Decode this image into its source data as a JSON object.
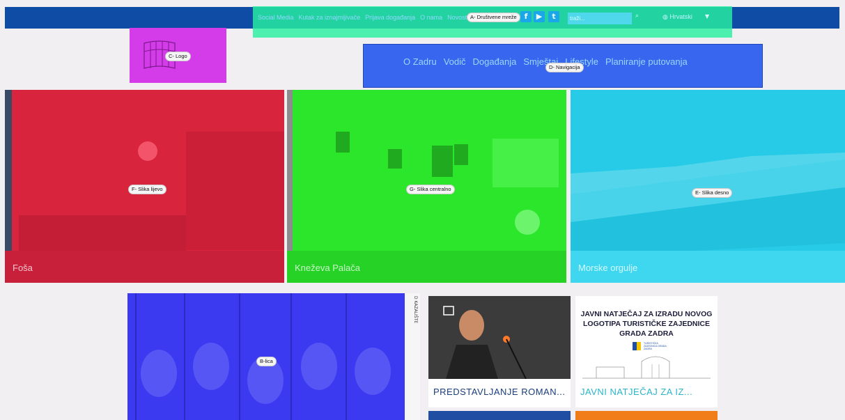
{
  "topbar": {
    "links": [
      "Social Media",
      "Kutak za iznajmljivače",
      "Prijava događanja",
      "O nama",
      "Novosti"
    ],
    "social_icons": [
      "facebook-icon",
      "youtube-icon",
      "twitter-icon"
    ],
    "search_placeholder": "traži...",
    "language": "Hrvatski"
  },
  "zones": {
    "a": "A- Društvene mreže",
    "b": "B-lica",
    "c": "C- Logo",
    "d": "D- Navigacija",
    "e": "E- Slika desno",
    "f": "F- Slika lijevo",
    "g": "G- Slika centralno"
  },
  "nav": {
    "items": [
      "O Zadru",
      "Vodič",
      "Događanja",
      "Smještaj",
      "Lifestyle",
      "Planiranje putovanja"
    ]
  },
  "hero": {
    "left": {
      "caption": "Foša"
    },
    "center": {
      "caption": "Kneževa Palača"
    },
    "right": {
      "caption": "Morske orgulje"
    }
  },
  "cards": [
    {
      "title": "PREDSTAVLJANJE ROMAN...",
      "title_color": "#1a3d7c"
    },
    {
      "title": "JAVNI NATJEČAJ ZA IZ...",
      "title_color": "#2ab4c8"
    }
  ],
  "card2_image_text": {
    "headline": "JAVNI NATJEČAJ ZA IZRADU NOVOG LOGOTIPA TURISTIČKE ZAJEDNICE GRADA ZADRA",
    "org": "TURISTIČKA ZAJEDNICA GRADA ZADRA"
  },
  "poster_text": "D KAZALIŠTE",
  "colors": {
    "topbar": "#0f4ca6",
    "zone_a": "#28f0a0",
    "zone_b": "#3b3af0",
    "zone_c": "#d43be9",
    "zone_d": "#3866ef",
    "zone_e": "#27cbe7",
    "zone_f": "#d9243d",
    "zone_g": "#2be62b"
  }
}
